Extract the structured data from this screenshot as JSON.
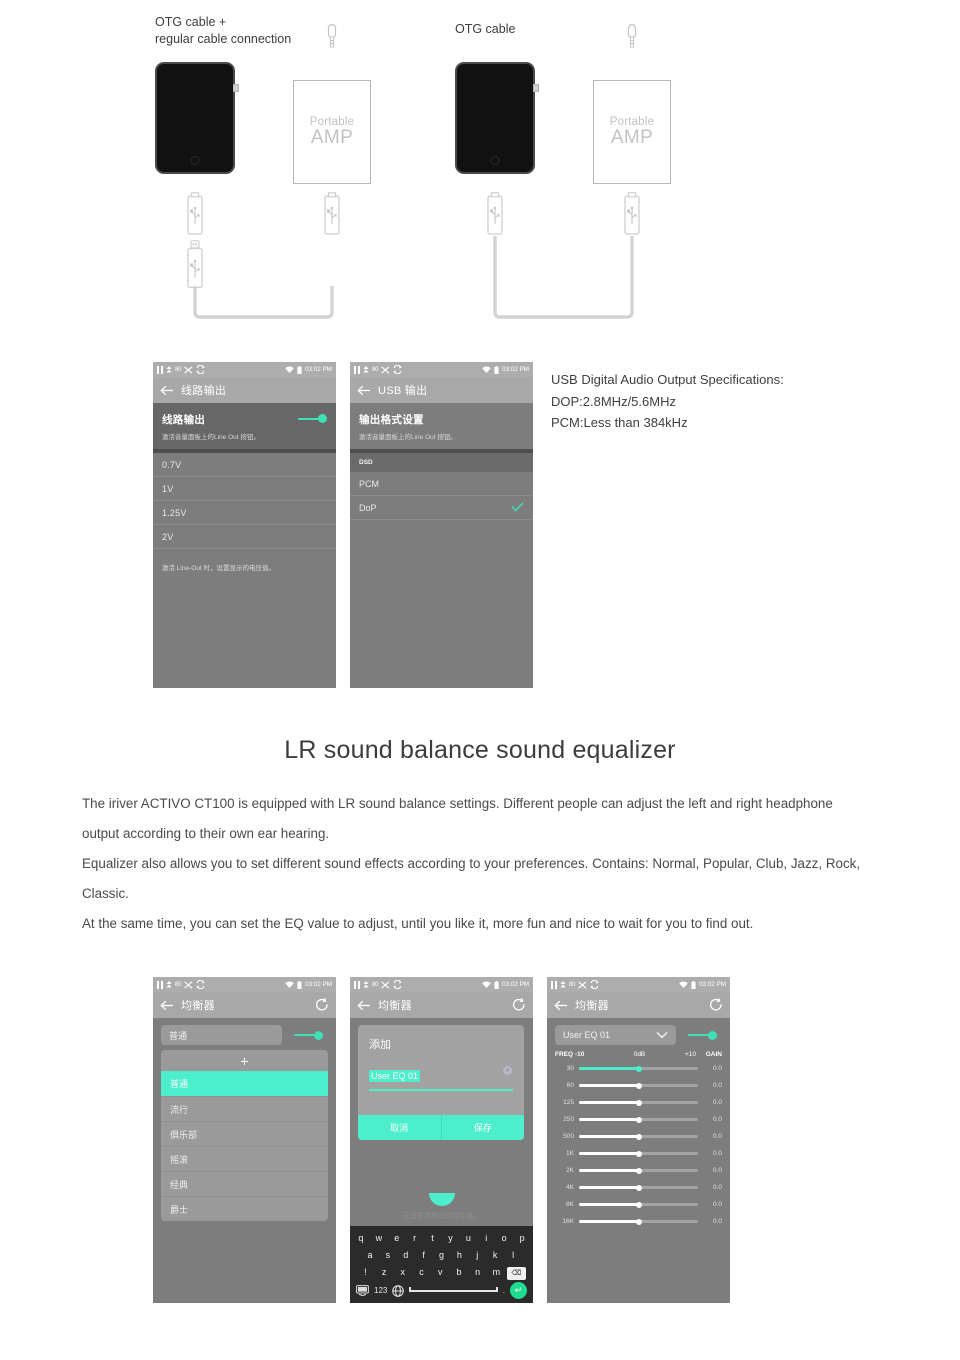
{
  "diagram": {
    "caption_left": "OTG cable +\nregular cable connection",
    "caption_right": "OTG cable",
    "amp_label_small": "Portable",
    "amp_label_big": "AMP"
  },
  "usb_spec": {
    "line1": "USB Digital Audio Output Specifications:",
    "line2": "DOP:2.8MHz/5.6MHz",
    "line3": "PCM:Less than 384kHz"
  },
  "statusbar": {
    "volume": "80",
    "time": "03:02 PM"
  },
  "lineout_screen": {
    "title": "线路输出",
    "section_title": "线路输出",
    "section_sub": "激活音量面板上的Line Out 按钮。",
    "options": [
      "0.7V",
      "1V",
      "1.25V",
      "2V"
    ],
    "footnote": "激活 Line-Out 时，设置显示的电压值。"
  },
  "usb_screen": {
    "title": "USB 输出",
    "section_title": "输出格式设置",
    "section_sub": "激活音量面板上的Line Out 按钮。",
    "group_header": "DSD",
    "options": [
      {
        "label": "PCM",
        "checked": false
      },
      {
        "label": "DoP",
        "checked": true
      }
    ]
  },
  "heading": "LR sound balance    sound equalizer",
  "paragraph": [
    "The iriver ACTIVO CT100 is equipped with LR sound balance settings. Different people can adjust the left and right headphone output according to their own ear hearing.",
    "Equalizer also allows you to set different sound effects according to your preferences. Contains: Normal, Popular, Club, Jazz, Rock, Classic.",
    "At the same time, you can set the EQ value to adjust, until you like it, more fun and nice to wait for you to find out."
  ],
  "eq_preset_screen": {
    "title": "均衡器",
    "current_preset": "普通",
    "add_label": "+",
    "presets": [
      {
        "label": "普通",
        "selected": true
      },
      {
        "label": "流行",
        "selected": false
      },
      {
        "label": "俱乐部",
        "selected": false
      },
      {
        "label": "摇滚",
        "selected": false
      },
      {
        "label": "经典",
        "selected": false
      },
      {
        "label": "爵士",
        "selected": false
      }
    ]
  },
  "eq_dialog_screen": {
    "title": "均衡器",
    "dialog_title": "添加",
    "input_value": "User EQ 01",
    "cancel_label": "取消",
    "save_label": "保存",
    "hint": "无法更改预设的增益值。",
    "keyboard": {
      "row1": [
        "q",
        "w",
        "e",
        "r",
        "t",
        "y",
        "u",
        "i",
        "o",
        "p"
      ],
      "row2": [
        "a",
        "s",
        "d",
        "f",
        "g",
        "h",
        "j",
        "k",
        "l"
      ],
      "row3": [
        "!",
        "z",
        "x",
        "c",
        "v",
        "b",
        "n",
        "m"
      ],
      "backspace": "⌫",
      "numbers_key": "123",
      "period_key": ".",
      "enter_key": "↵"
    }
  },
  "eq_slider_screen": {
    "title": "均衡器",
    "preset_name": "User EQ 01",
    "legend": {
      "freq": "FREQ",
      "min": "-10",
      "mid": "0dB",
      "max": "+10",
      "gain": "GAIN"
    },
    "bands": [
      {
        "freq": "30",
        "gain": "0.0",
        "active": true
      },
      {
        "freq": "60",
        "gain": "0.0",
        "active": false
      },
      {
        "freq": "125",
        "gain": "0.0",
        "active": false
      },
      {
        "freq": "250",
        "gain": "0.0",
        "active": false
      },
      {
        "freq": "500",
        "gain": "0.0",
        "active": false
      },
      {
        "freq": "1K",
        "gain": "0.0",
        "active": false
      },
      {
        "freq": "2K",
        "gain": "0.0",
        "active": false
      },
      {
        "freq": "4K",
        "gain": "0.0",
        "active": false
      },
      {
        "freq": "8K",
        "gain": "0.0",
        "active": false
      },
      {
        "freq": "16K",
        "gain": "0.0",
        "active": false
      }
    ]
  },
  "colors": {
    "accent": "#4deecb",
    "toggle": "#3ee0b6",
    "screen_bg": "#7d7d7d",
    "appbar": "#a8a8a8",
    "statusbar": "#adadad",
    "keyboard_bg": "#2b2b2b",
    "enter_key": "#1ddb8f"
  }
}
